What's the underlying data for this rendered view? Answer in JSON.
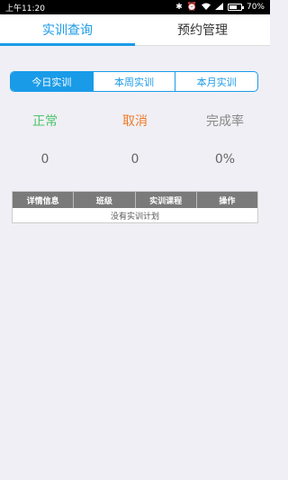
{
  "status_bar": {
    "time": "上午11:20",
    "battery": "70%",
    "battery_level": 0.7
  },
  "tabs": [
    {
      "label": "实训查询",
      "active": true
    },
    {
      "label": "预约管理",
      "active": false
    }
  ],
  "segments": [
    {
      "label": "今日实训",
      "active": true
    },
    {
      "label": "本周实训",
      "active": false
    },
    {
      "label": "本月实训",
      "active": false
    }
  ],
  "stats": [
    {
      "label": "正常",
      "value": "0"
    },
    {
      "label": "取消",
      "value": "0"
    },
    {
      "label": "完成率",
      "value": "0%"
    }
  ],
  "table": {
    "headers": [
      "详情信息",
      "班级",
      "实训课程",
      "操作"
    ],
    "empty_text": "没有实训计划"
  },
  "colors": {
    "accent": "#1a9be8",
    "normal": "#4cc569",
    "cancel": "#f07b2a",
    "table_header": "#7a7a7a",
    "background": "#f0eff5"
  },
  "icons": [
    "bluetooth-icon",
    "alarm-icon",
    "wifi-icon",
    "signal-icon",
    "battery-icon"
  ]
}
